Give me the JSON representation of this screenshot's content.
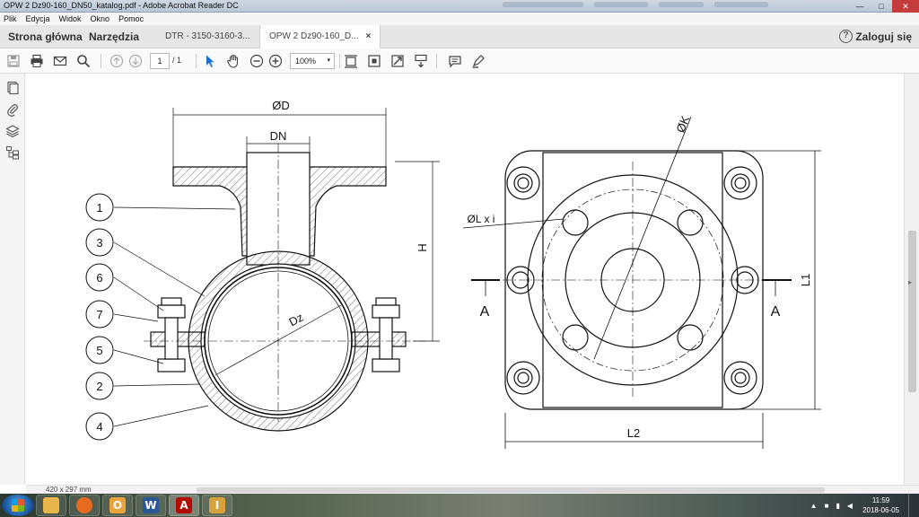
{
  "window": {
    "title": "OPW 2 Dz90-160_DN50_katalog.pdf - Adobe Acrobat Reader DC",
    "min": "—",
    "max": "□",
    "close": "✕"
  },
  "menu": [
    "Plik",
    "Edycja",
    "Widok",
    "Okno",
    "Pomoc"
  ],
  "tabs": {
    "home": "Strona główna",
    "tools": "Narzędzia",
    "doc1": "DTR - 3150-3160-3...",
    "doc2": "OPW 2 Dz90-160_D...",
    "close": "×",
    "help": "?",
    "login": "Zaloguj się"
  },
  "toolbar": {
    "page_current": "1",
    "page_total": "/ 1",
    "zoom": "100%",
    "zoom_caret": "▾",
    "icons": [
      "save-icon",
      "print-icon",
      "email-icon",
      "search-icon",
      "page-up-icon",
      "page-down-icon",
      "select-cursor-icon",
      "hand-icon",
      "zoom-out-icon",
      "zoom-in-icon",
      "fit-page-icon",
      "full-screen-icon",
      "rotate-icon",
      "scroll-mode-icon",
      "comment-icon",
      "highlight-icon"
    ]
  },
  "side_panel_icons": [
    "pages-icon",
    "attachments-icon",
    "layers-icon",
    "structure-icon"
  ],
  "drawing": {
    "label_OD": "ØD",
    "label_DN": "DN",
    "label_H": "H",
    "label_Dz": "Dz",
    "label_OK": "ØK",
    "label_OL": "ØL x i",
    "label_A_left": "A",
    "label_A_right": "A",
    "label_L1": "L1",
    "label_L2": "L2",
    "balloons": [
      "1",
      "3",
      "6",
      "7",
      "5",
      "2",
      "4"
    ]
  },
  "status": {
    "page_size": "420 x 297 mm"
  },
  "taskbar": {
    "apps": [
      {
        "name": "explorer",
        "glyph": "",
        "color": "#e8b64a"
      },
      {
        "name": "firefox",
        "glyph": "",
        "color": "#e66a1f"
      },
      {
        "name": "outlook",
        "glyph": "O",
        "color": "#e8a33a"
      },
      {
        "name": "word",
        "glyph": "W",
        "color": "#2b5797"
      },
      {
        "name": "acrobat",
        "glyph": "A",
        "color": "#b30b00"
      },
      {
        "name": "inventor",
        "glyph": "I",
        "color": "#d8a23a"
      }
    ],
    "time": "11:59",
    "date": "2018-06-05"
  }
}
